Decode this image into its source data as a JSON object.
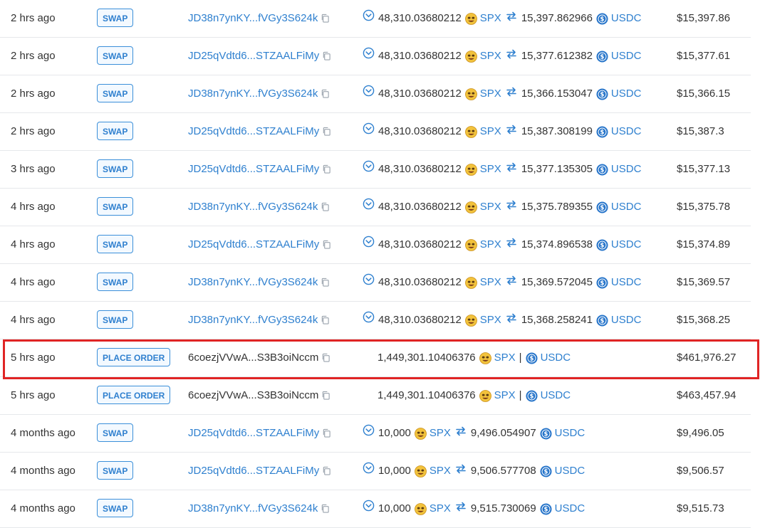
{
  "rows": [
    {
      "time": "2 hrs ago",
      "type": "SWAP",
      "signer": "JD38n7ynKY...fVGy3S624k",
      "signer_link": true,
      "amount_in": "48,310.03680212",
      "token_in": "SPX",
      "amount_out": "15,397.862966",
      "token_out": "USDC",
      "value": "$15,397.86"
    },
    {
      "time": "2 hrs ago",
      "type": "SWAP",
      "signer": "JD25qVdtd6...STZAALFiMy",
      "signer_link": true,
      "amount_in": "48,310.03680212",
      "token_in": "SPX",
      "amount_out": "15,377.612382",
      "token_out": "USDC",
      "value": "$15,377.61"
    },
    {
      "time": "2 hrs ago",
      "type": "SWAP",
      "signer": "JD38n7ynKY...fVGy3S624k",
      "signer_link": true,
      "amount_in": "48,310.03680212",
      "token_in": "SPX",
      "amount_out": "15,366.153047",
      "token_out": "USDC",
      "value": "$15,366.15"
    },
    {
      "time": "2 hrs ago",
      "type": "SWAP",
      "signer": "JD25qVdtd6...STZAALFiMy",
      "signer_link": true,
      "amount_in": "48,310.03680212",
      "token_in": "SPX",
      "amount_out": "15,387.308199",
      "token_out": "USDC",
      "value": "$15,387.3"
    },
    {
      "time": "3 hrs ago",
      "type": "SWAP",
      "signer": "JD25qVdtd6...STZAALFiMy",
      "signer_link": true,
      "amount_in": "48,310.03680212",
      "token_in": "SPX",
      "amount_out": "15,377.135305",
      "token_out": "USDC",
      "value": "$15,377.13"
    },
    {
      "time": "4 hrs ago",
      "type": "SWAP",
      "signer": "JD38n7ynKY...fVGy3S624k",
      "signer_link": true,
      "amount_in": "48,310.03680212",
      "token_in": "SPX",
      "amount_out": "15,375.789355",
      "token_out": "USDC",
      "value": "$15,375.78"
    },
    {
      "time": "4 hrs ago",
      "type": "SWAP",
      "signer": "JD25qVdtd6...STZAALFiMy",
      "signer_link": true,
      "amount_in": "48,310.03680212",
      "token_in": "SPX",
      "amount_out": "15,374.896538",
      "token_out": "USDC",
      "value": "$15,374.89"
    },
    {
      "time": "4 hrs ago",
      "type": "SWAP",
      "signer": "JD38n7ynKY...fVGy3S624k",
      "signer_link": true,
      "amount_in": "48,310.03680212",
      "token_in": "SPX",
      "amount_out": "15,369.572045",
      "token_out": "USDC",
      "value": "$15,369.57"
    },
    {
      "time": "4 hrs ago",
      "type": "SWAP",
      "signer": "JD38n7ynKY...fVGy3S624k",
      "signer_link": true,
      "amount_in": "48,310.03680212",
      "token_in": "SPX",
      "amount_out": "15,368.258241",
      "token_out": "USDC",
      "value": "$15,368.25"
    },
    {
      "time": "5 hrs ago",
      "type": "PLACE ORDER",
      "signer": "6coezjVVwA...S3B3oiNccm",
      "signer_link": false,
      "order_amount": "1,449,301.10406376",
      "token_in": "SPX",
      "token_out": "USDC",
      "value": "$461,976.27",
      "highlighted": true
    },
    {
      "time": "5 hrs ago",
      "type": "PLACE ORDER",
      "signer": "6coezjVVwA...S3B3oiNccm",
      "signer_link": false,
      "order_amount": "1,449,301.10406376",
      "token_in": "SPX",
      "token_out": "USDC",
      "value": "$463,457.94"
    },
    {
      "time": "4 months ago",
      "type": "SWAP",
      "signer": "JD25qVdtd6...STZAALFiMy",
      "signer_link": true,
      "amount_in": "10,000",
      "token_in": "SPX",
      "amount_out": "9,496.054907",
      "token_out": "USDC",
      "value": "$9,496.05"
    },
    {
      "time": "4 months ago",
      "type": "SWAP",
      "signer": "JD25qVdtd6...STZAALFiMy",
      "signer_link": true,
      "amount_in": "10,000",
      "token_in": "SPX",
      "amount_out": "9,506.577708",
      "token_out": "USDC",
      "value": "$9,506.57"
    },
    {
      "time": "4 months ago",
      "type": "SWAP",
      "signer": "JD38n7ynKY...fVGy3S624k",
      "signer_link": true,
      "amount_in": "10,000",
      "token_in": "SPX",
      "amount_out": "9,515.730069",
      "token_out": "USDC",
      "value": "$9,515.73"
    }
  ],
  "icons": {
    "expand": "chevron-circle-icon",
    "token_in": "spx-token-icon",
    "token_out": "usdc-token-icon",
    "swap_arrow": "swap-arrows-icon",
    "copy": "copy-icon"
  },
  "colors": {
    "link": "#2f80cf",
    "highlight_border": "#e02424",
    "badge_border": "#3b8fd9"
  }
}
